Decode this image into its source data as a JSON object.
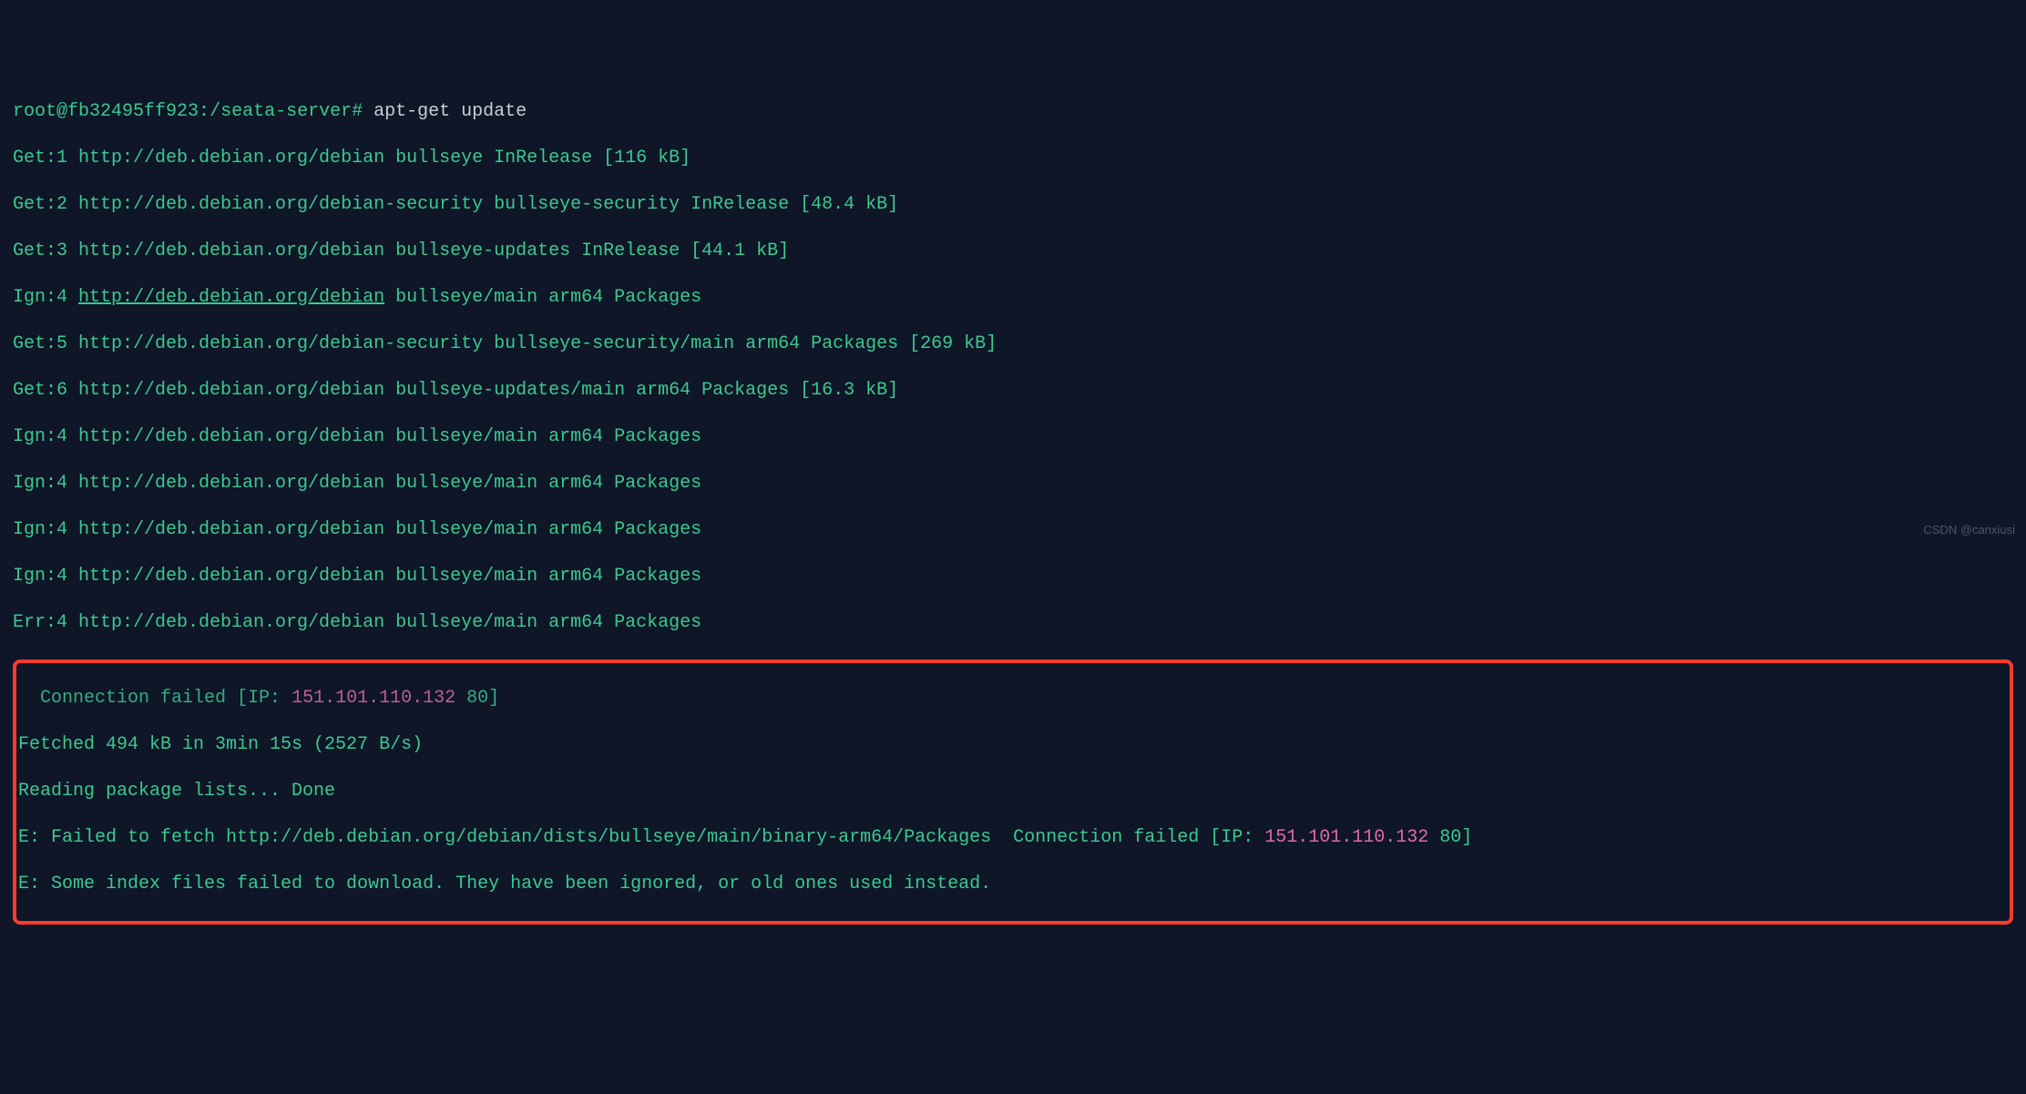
{
  "prompt": {
    "user_host": "root@fb32495ff923",
    "path": "/seata-server",
    "symbol": "#",
    "command": "apt-get update"
  },
  "lines": [
    {
      "prefix": "Get:1 ",
      "body": "http://deb.debian.org/debian bullseye InRelease [116 kB]"
    },
    {
      "prefix": "Get:2 ",
      "body": "http://deb.debian.org/debian-security bullseye-security InRelease [48.4 kB]"
    },
    {
      "prefix": "Get:3 ",
      "body": "http://deb.debian.org/debian bullseye-updates InRelease [44.1 kB]"
    },
    {
      "prefix": "Ign:4 ",
      "url": "http://deb.debian.org/debian",
      "rest": " bullseye/main arm64 Packages"
    },
    {
      "prefix": "Get:5 ",
      "body": "http://deb.debian.org/debian-security bullseye-security/main arm64 Packages [269 kB]"
    },
    {
      "prefix": "Get:6 ",
      "body": "http://deb.debian.org/debian bullseye-updates/main arm64 Packages [16.3 kB]"
    },
    {
      "prefix": "Ign:4 ",
      "body": "http://deb.debian.org/debian bullseye/main arm64 Packages"
    },
    {
      "prefix": "Ign:4 ",
      "body": "http://deb.debian.org/debian bullseye/main arm64 Packages"
    },
    {
      "prefix": "Ign:4 ",
      "body": "http://deb.debian.org/debian bullseye/main arm64 Packages"
    },
    {
      "prefix": "Ign:4 ",
      "body": "http://deb.debian.org/debian bullseye/main arm64 Packages"
    },
    {
      "prefix": "Err:4 ",
      "body": "http://deb.debian.org/debian bullseye/main arm64 Packages"
    }
  ],
  "errorbox": {
    "conn_failed_pre": "  Connection failed [IP: ",
    "conn_failed_ip": "151.101.110.132",
    "conn_failed_post": " 80]",
    "fetched": "Fetched 494 kB in 3min 15s (2527 B/s)",
    "reading": "Reading package lists... Done",
    "e1_pre": "E: Failed to fetch http://deb.debian.org/debian/dists/bullseye/main/binary-arm64/Packages  Connection failed [IP: ",
    "e1_ip": "151.101.110.132",
    "e1_post": " 80]",
    "e2": "E: Some index files failed to download. They have been ignored, or old ones used instead."
  },
  "watermark": "CSDN @canxiusi"
}
